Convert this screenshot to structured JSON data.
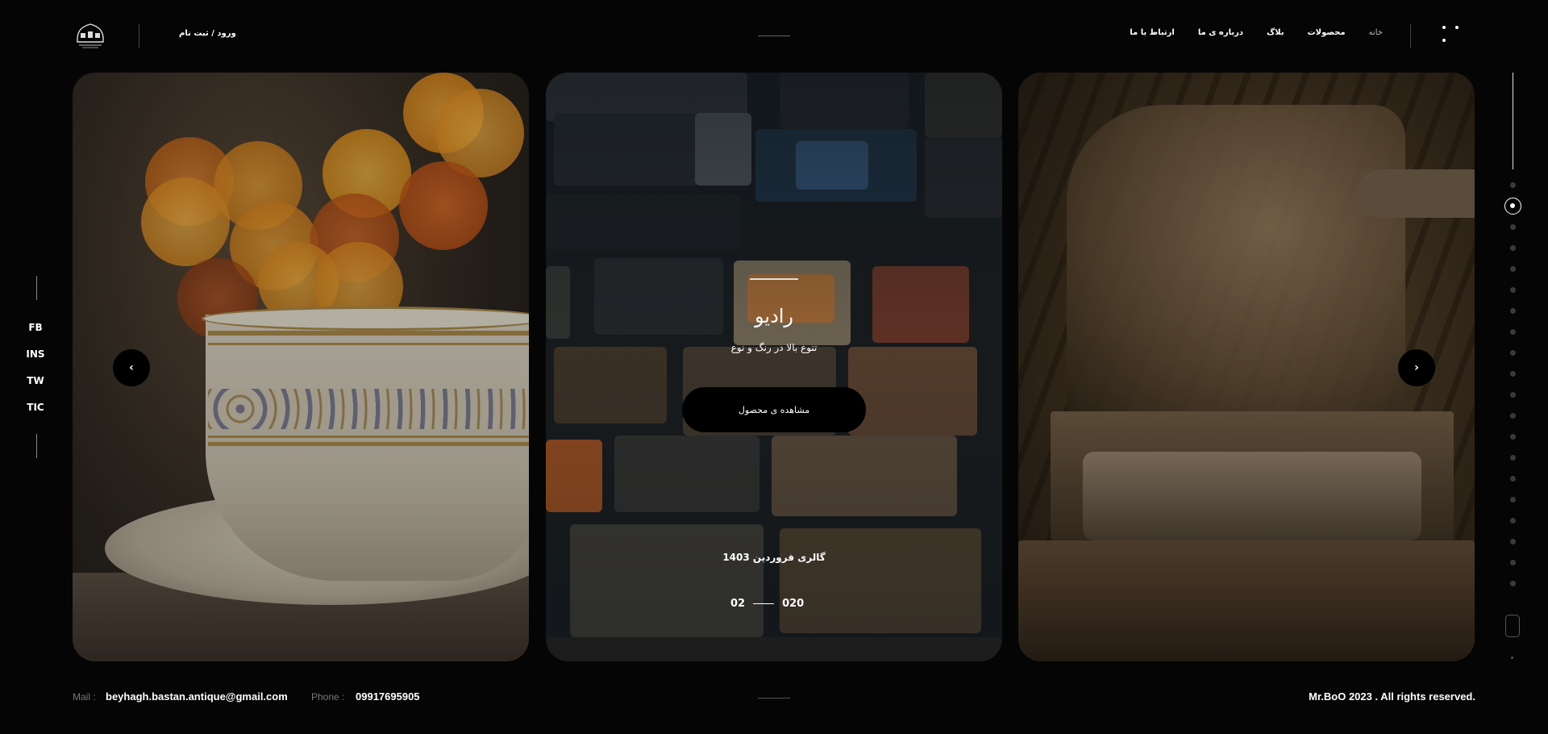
{
  "header": {
    "login_label": "ورود / ثبت نام",
    "nav": [
      {
        "label": "خانه",
        "active": true
      },
      {
        "label": "محصولات",
        "active": false
      },
      {
        "label": "بلاگ",
        "active": false
      },
      {
        "label": "درباره ی ما",
        "active": false
      },
      {
        "label": "ارتباط با ما",
        "active": false
      }
    ],
    "icons": {
      "logo": "antique-shop-logo-icon",
      "menu": "menu-dots-icon"
    }
  },
  "social": [
    "FB",
    "INS",
    "TW",
    "TIC"
  ],
  "slider": {
    "title": "رادیو",
    "subtitle": "تنوع بالا در رنگ و نوع",
    "cta_label": "مشاهده ی محصول",
    "gallery_text": "گالری فروردین 1403",
    "current": "02",
    "total": "020",
    "icons": {
      "prev": "chevron-left-icon",
      "next": "chevron-right-icon"
    }
  },
  "pagination": {
    "count": 20,
    "active_index": 1
  },
  "footer": {
    "mail_label": "Mail :",
    "mail_value": "beyhagh.bastan.antique@gmail.com",
    "phone_label": "Phone :",
    "phone_value": "09917695905",
    "copyright": "Mr.BoO 2023 . All rights reserved."
  },
  "colors": {
    "background": "#050505",
    "text": "#ffffff",
    "muted": "#777777"
  }
}
